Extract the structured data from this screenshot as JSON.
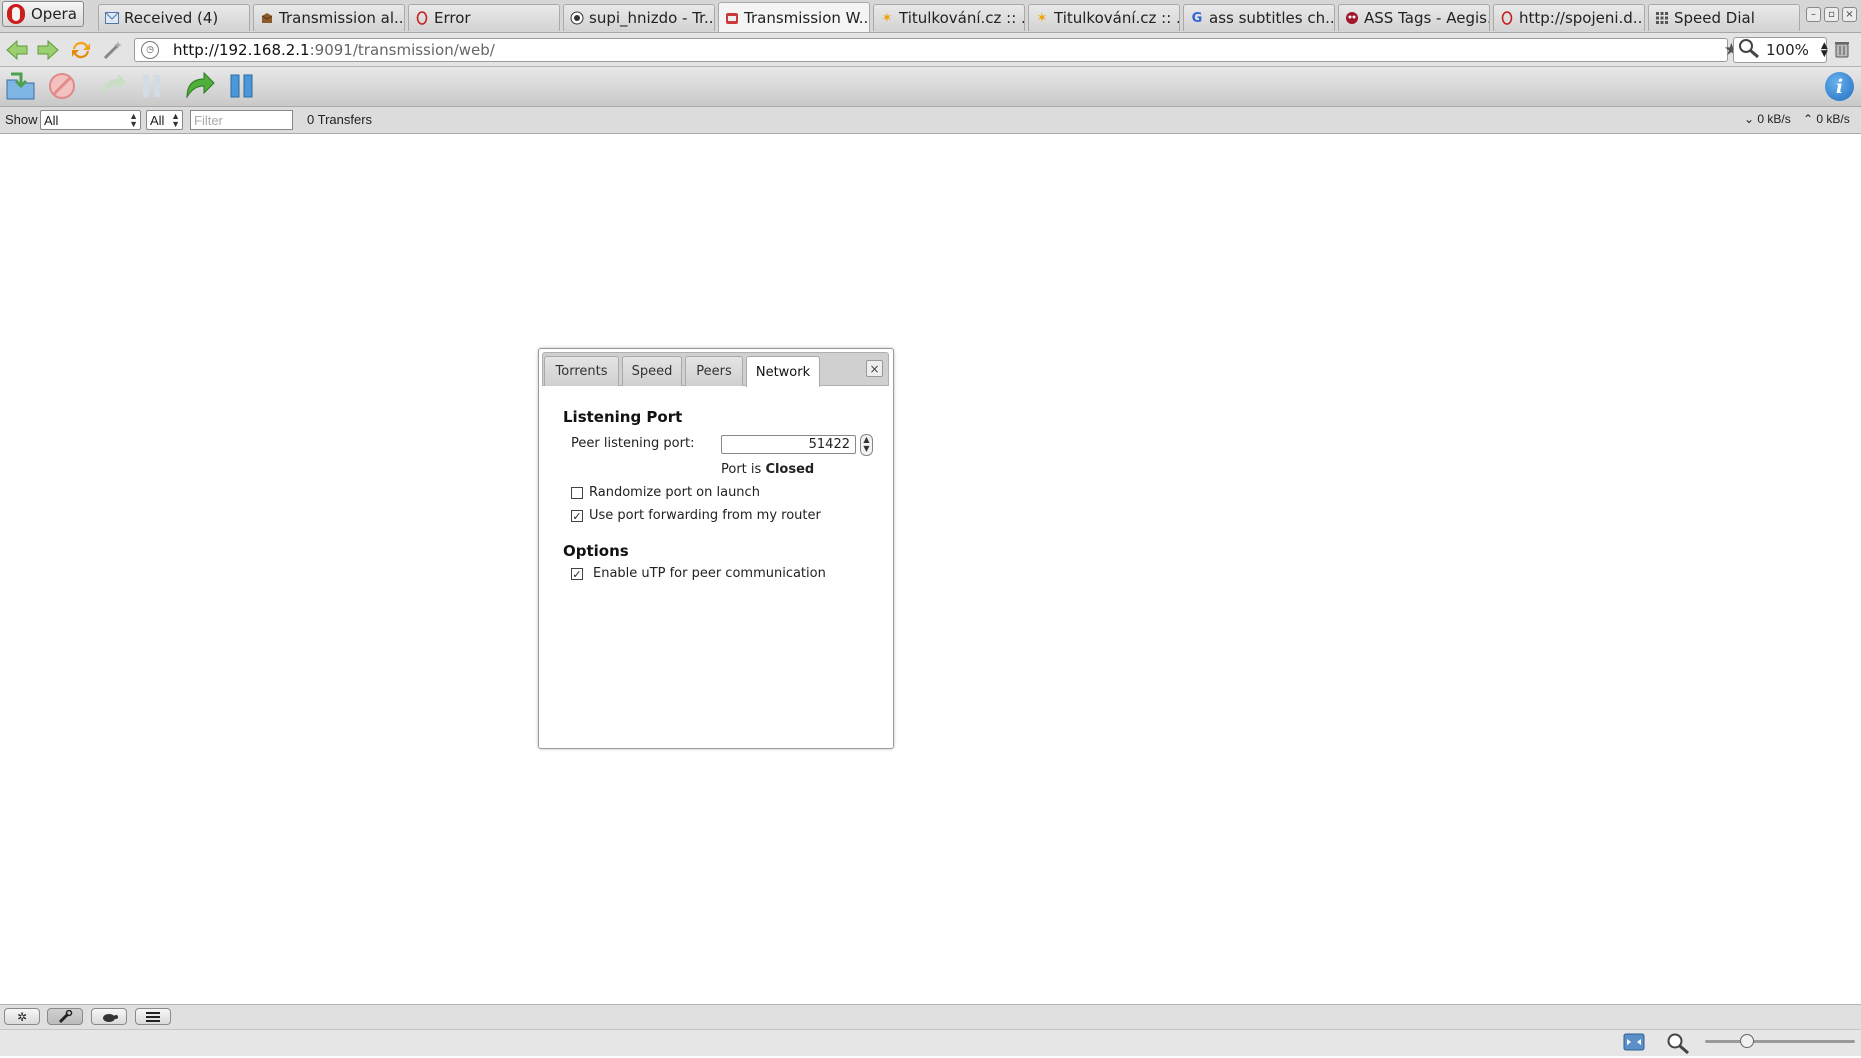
{
  "browser": {
    "menu_label": "Opera",
    "tabs": [
      {
        "label": "Received (4)",
        "icon": "mail-icon"
      },
      {
        "label": "Transmission al...",
        "icon": "box-icon"
      },
      {
        "label": "Error",
        "icon": "opera-page-icon"
      },
      {
        "label": "supi_hnizdo - Tr...",
        "icon": "eye-icon"
      },
      {
        "label": "Transmission W...",
        "icon": "transmission-icon"
      },
      {
        "label": "Titulkování.cz :: ...",
        "icon": "star-burst-icon"
      },
      {
        "label": "Titulkování.cz :: ...",
        "icon": "star-burst-icon"
      },
      {
        "label": "ass subtitles ch...",
        "icon": "google-icon"
      },
      {
        "label": "ASS Tags - Aegis...",
        "icon": "aegisub-icon"
      },
      {
        "label": "http://spojeni.d...",
        "icon": "opera-page-icon"
      },
      {
        "label": "Speed Dial",
        "icon": "grid-icon"
      }
    ],
    "active_tab_index": 4,
    "url_host": "http://192.168.2.1",
    "url_rest": ":9091/transmission/web/",
    "zoom": "100%"
  },
  "filter": {
    "show_label": "Show",
    "status_select": "All",
    "tracker_select": "All",
    "filter_placeholder": "Filter",
    "transfers": "0 Transfers",
    "download_speed": "0 kB/s",
    "upload_speed": "0 kB/s"
  },
  "dialog": {
    "tabs": [
      "Torrents",
      "Speed",
      "Peers",
      "Network"
    ],
    "active_tab": "Network",
    "close_symbol": "×",
    "listening_heading": "Listening Port",
    "peer_port_label": "Peer listening port:",
    "peer_port_value": "51422",
    "port_status_prefix": "Port is",
    "port_status": "Closed",
    "randomize_label": "Randomize port on launch",
    "randomize_checked": false,
    "forwarding_label": "Use port forwarding from my router",
    "forwarding_checked": true,
    "options_heading": "Options",
    "utp_label": "Enable uTP for peer communication",
    "utp_checked": true
  },
  "colors": {
    "accent_blue": "#2a7fd4",
    "green_arrow": "#3aa23a",
    "opera_red": "#cc1c1c"
  }
}
